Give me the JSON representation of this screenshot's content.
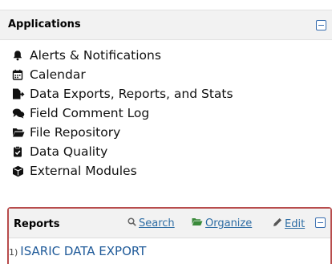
{
  "applications": {
    "title": "Applications",
    "items": [
      {
        "label": "Alerts & Notifications",
        "icon": "bell-icon"
      },
      {
        "label": "Calendar",
        "icon": "calendar-icon"
      },
      {
        "label": "Data Exports, Reports, and Stats",
        "icon": "file-export-icon"
      },
      {
        "label": "Field Comment Log",
        "icon": "comments-icon"
      },
      {
        "label": "File Repository",
        "icon": "folder-open-icon"
      },
      {
        "label": "Data Quality",
        "icon": "clipboard-check-icon"
      },
      {
        "label": "External Modules",
        "icon": "cube-icon"
      }
    ]
  },
  "reports": {
    "title": "Reports",
    "search_label": "Search",
    "organize_label": "Organize",
    "edit_label": "Edit",
    "items": [
      {
        "number": "1)",
        "title": "ISARIC DATA EXPORT"
      }
    ]
  },
  "colors": {
    "link": "#2e6da4",
    "highlight_border": "#b84c4c",
    "header_bg": "#f2f2f2",
    "organize_icon": "#3a8a3a"
  }
}
